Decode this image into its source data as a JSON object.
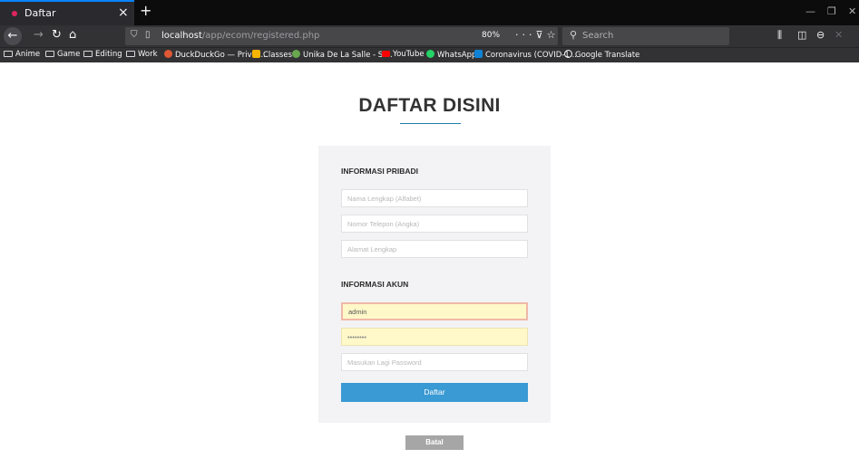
{
  "browser": {
    "tab_title": "Daftar",
    "tab_close": "×",
    "new_tab": "+",
    "url_host": "localhost",
    "url_path": "/app/ecom/registered.php",
    "zoom": "80%",
    "search_placeholder": "Search",
    "icons": [
      "back-icon",
      "forward-icon",
      "reload-icon",
      "home-icon",
      "shield-icon",
      "page-icon",
      "more-icon",
      "pocket-icon",
      "star-icon",
      "search-icon",
      "library-icon",
      "sidebar-icon",
      "account-icon",
      "minimize-icon",
      "restore-icon",
      "close-icon"
    ],
    "accent_color": "#0a84ff"
  },
  "bookmarks": [
    {
      "label": "Anime",
      "icon": "folder-icon"
    },
    {
      "label": "Game",
      "icon": "folder-icon"
    },
    {
      "label": "Editing",
      "icon": "folder-icon"
    },
    {
      "label": "Work",
      "icon": "folder-icon"
    },
    {
      "label": "DuckDuckGo — Privac...",
      "icon": "duckduckgo-icon"
    },
    {
      "label": "Classes",
      "icon": "classroom-icon"
    },
    {
      "label": "Unika De La Salle - Sl...",
      "icon": "unika-icon"
    },
    {
      "label": "YouTube",
      "icon": "youtube-icon"
    },
    {
      "label": "WhatsApp",
      "icon": "whatsapp-icon"
    },
    {
      "label": "Coronavirus (COVID-1...",
      "icon": "bing-icon"
    },
    {
      "label": "Google Translate",
      "icon": "globe-icon"
    }
  ],
  "page": {
    "title": "DAFTAR DISINI",
    "personal_section": "INFORMASI PRIBADI",
    "account_section": "INFORMASI AKUN",
    "fields": {
      "full_name_placeholder": "Nama Lengkap (Alfabet)",
      "phone_placeholder": "Nomor Telepon (Angka)",
      "address_placeholder": "Alamat Lengkap",
      "username_value": "admin",
      "password_value": "••••••••",
      "confirm_password_placeholder": "Masukan Lagi Password"
    },
    "submit_label": "Daftar",
    "cancel_label": "Batal",
    "submit_color": "#3a9ad3",
    "autofill_color": "#fff8c9"
  }
}
